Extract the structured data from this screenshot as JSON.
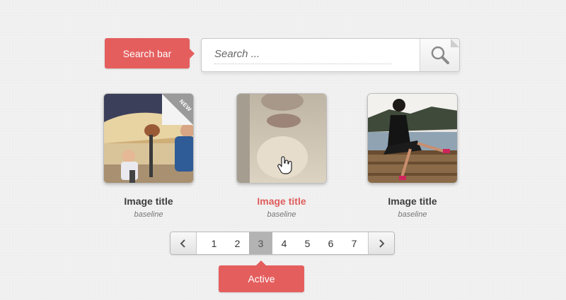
{
  "search": {
    "tag_label": "Search bar",
    "placeholder": "Search ..."
  },
  "cards": [
    {
      "title": "Image title",
      "subtitle": "baseline",
      "badge": "NEW"
    },
    {
      "title": "Image title",
      "subtitle": "baseline"
    },
    {
      "title": "Image title",
      "subtitle": "baseline"
    }
  ],
  "pagination": {
    "pages": [
      "1",
      "2",
      "3",
      "4",
      "5",
      "6",
      "7"
    ],
    "active_page": "3",
    "prev_icon": "chevron-left-icon",
    "next_icon": "chevron-right-icon",
    "tag_label": "Active"
  },
  "colors": {
    "accent": "#e55e5e",
    "hover_title": "#e05c5c",
    "active_page_bg": "#b3b3b3"
  }
}
